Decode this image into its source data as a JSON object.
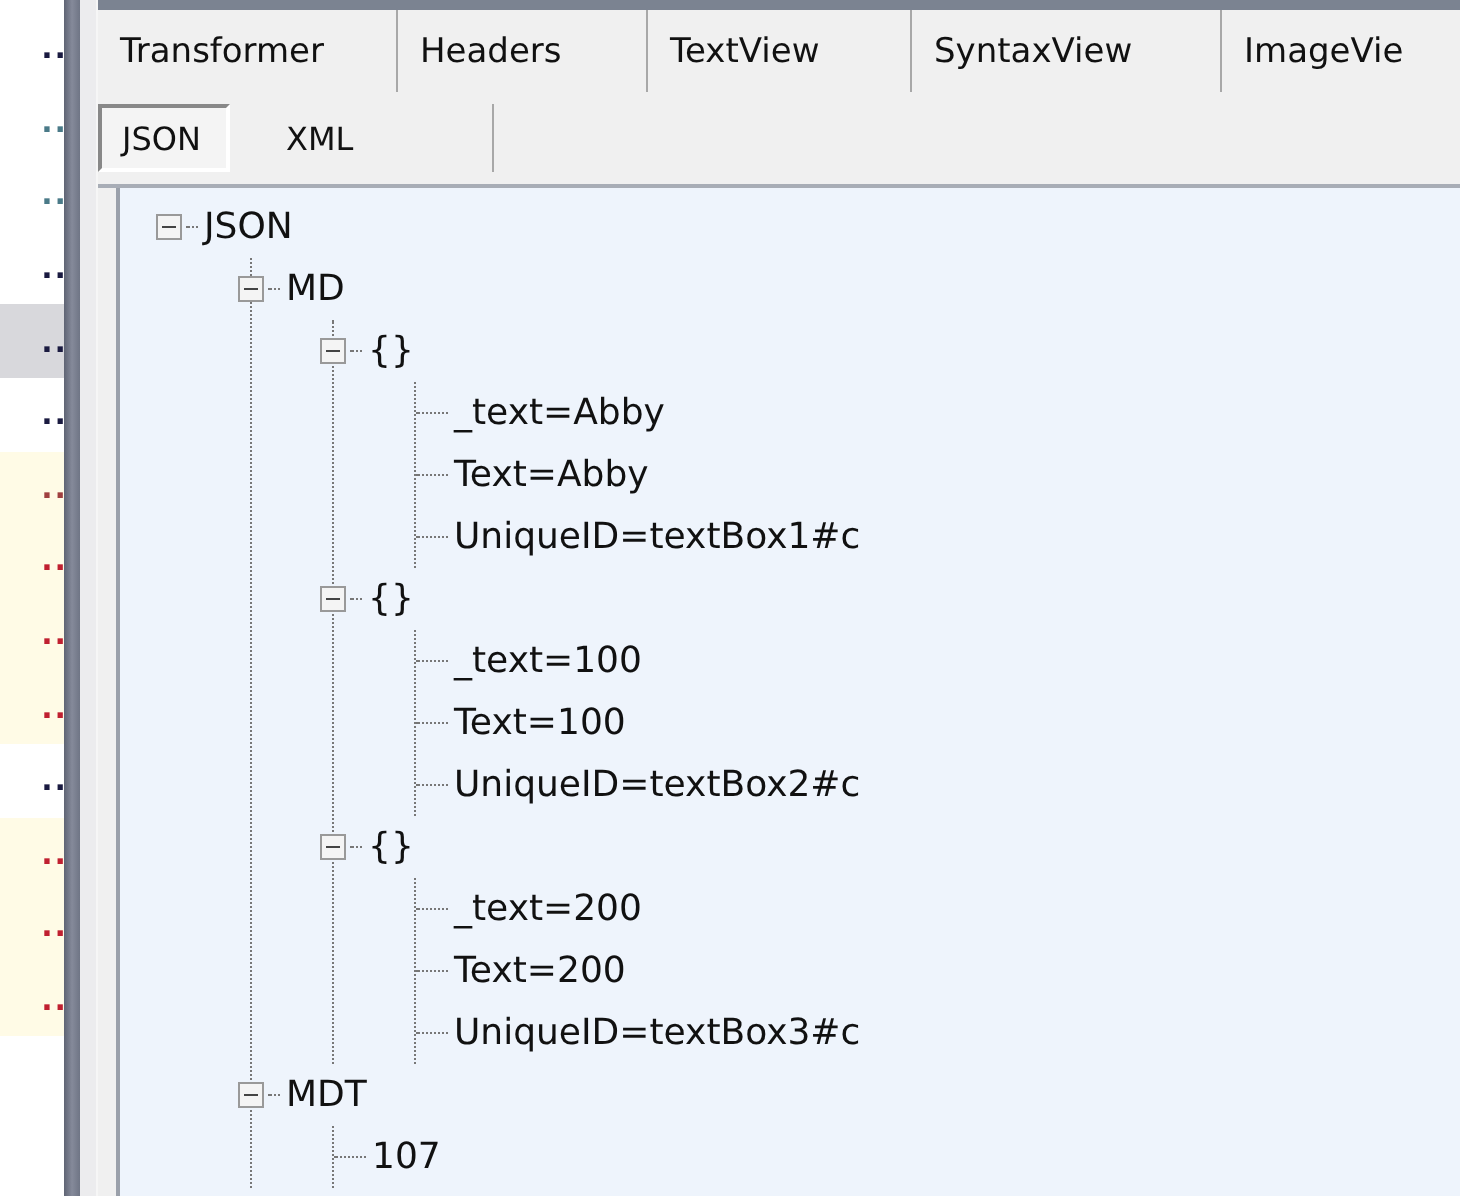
{
  "side_list": [
    {
      "text": "..",
      "color": "#1a1a40",
      "selected": false,
      "kind": "plain"
    },
    {
      "text": "..",
      "color": "#4a7a88",
      "selected": false,
      "kind": "plain"
    },
    {
      "text": "..",
      "color": "#4a7a88",
      "selected": false,
      "kind": "plain"
    },
    {
      "text": "..",
      "color": "#1a1a40",
      "selected": false,
      "kind": "plain"
    },
    {
      "text": "..",
      "color": "#1a1a40",
      "selected": true,
      "kind": "plain"
    },
    {
      "text": "..",
      "color": "#1a1a40",
      "selected": false,
      "kind": "plain"
    },
    {
      "text": "..",
      "color": "#a04040",
      "selected": false,
      "kind": "highlighted"
    },
    {
      "text": "..",
      "color": "#c02030",
      "selected": false,
      "kind": "highlighted"
    },
    {
      "text": "..",
      "color": "#c02030",
      "selected": false,
      "kind": "highlighted"
    },
    {
      "text": "..",
      "color": "#c02030",
      "selected": false,
      "kind": "highlighted"
    },
    {
      "text": "..",
      "color": "#1a1a40",
      "selected": false,
      "kind": "plain"
    },
    {
      "text": "..",
      "color": "#c02030",
      "selected": false,
      "kind": "highlighted"
    },
    {
      "text": "..",
      "color": "#c02030",
      "selected": false,
      "kind": "highlighted"
    },
    {
      "text": "..",
      "color": "#c02030",
      "selected": false,
      "kind": "highlighted"
    }
  ],
  "tabs": [
    {
      "label": "Transformer",
      "selected": false
    },
    {
      "label": "Headers",
      "selected": false
    },
    {
      "label": "TextView",
      "selected": false
    },
    {
      "label": "SyntaxView",
      "selected": false
    },
    {
      "label": "ImageVie",
      "selected": false
    }
  ],
  "subtabs": [
    {
      "label": "JSON",
      "selected": true
    },
    {
      "label": "XML",
      "selected": false
    }
  ],
  "tree": [
    {
      "label": "JSON",
      "expanded": true,
      "children": [
        {
          "label": "MD",
          "expanded": true,
          "children": [
            {
              "label": "{}",
              "expanded": true,
              "children": [
                {
                  "label": "_text=Abby"
                },
                {
                  "label": "Text=Abby"
                },
                {
                  "label": "UniqueID=textBox1#c"
                }
              ]
            },
            {
              "label": "{}",
              "expanded": true,
              "children": [
                {
                  "label": "_text=100"
                },
                {
                  "label": "Text=100"
                },
                {
                  "label": "UniqueID=textBox2#c"
                }
              ]
            },
            {
              "label": "{}",
              "expanded": true,
              "children": [
                {
                  "label": "_text=200"
                },
                {
                  "label": "Text=200"
                },
                {
                  "label": "UniqueID=textBox3#c"
                }
              ]
            }
          ]
        },
        {
          "label": "MDT",
          "expanded": true,
          "children": [
            {
              "label": "107"
            }
          ]
        }
      ]
    }
  ]
}
